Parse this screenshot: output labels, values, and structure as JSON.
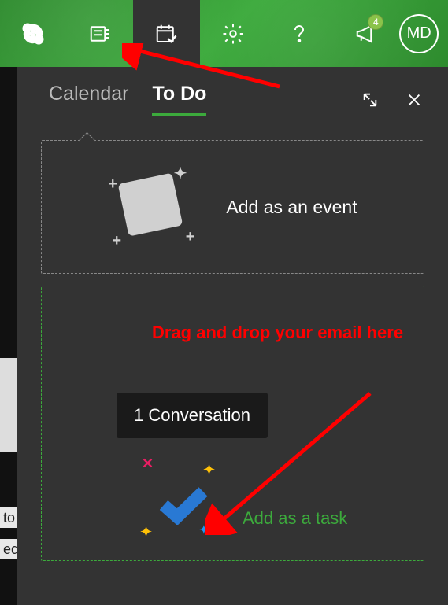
{
  "topbar": {
    "badge_count": "4",
    "avatar_initials": "MD"
  },
  "tabs": {
    "calendar_label": "Calendar",
    "todo_label": "To Do"
  },
  "event_card": {
    "label": "Add as an event"
  },
  "task_card": {
    "conversation_label": "1 Conversation",
    "task_label": "Add as a task"
  },
  "annotation": {
    "text": "Drag and drop your email here"
  },
  "left_fragments": {
    "a": "to",
    "b": "ed"
  }
}
